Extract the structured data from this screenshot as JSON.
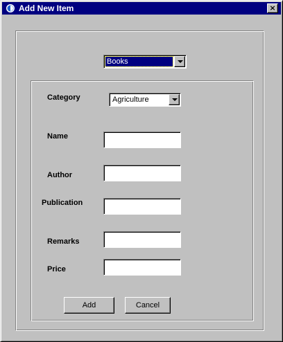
{
  "window": {
    "title": "Add New Item",
    "close_label": "×"
  },
  "item_type_select": {
    "selected": "Books"
  },
  "form": {
    "category": {
      "label": "Category",
      "selected": "Agriculture"
    },
    "name": {
      "label": "Name",
      "value": ""
    },
    "author": {
      "label": "Author",
      "value": ""
    },
    "publication": {
      "label": "Publication",
      "value": ""
    },
    "remarks": {
      "label": "Remarks",
      "value": ""
    },
    "price": {
      "label": "Price",
      "value": ""
    }
  },
  "buttons": {
    "add_label": "Add",
    "cancel_label": "Cancel"
  },
  "icons": {
    "app": "app-icon",
    "close": "close-icon",
    "dropdown": "chevron-down-icon"
  },
  "colors": {
    "titlebar": "#000080",
    "face": "#c0c0c0"
  }
}
